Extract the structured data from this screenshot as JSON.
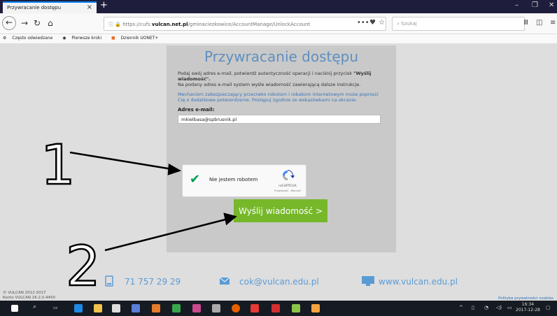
{
  "browser": {
    "tab_title": "Przywracanie dostępu",
    "tab_close": "×",
    "new_tab": "+",
    "url_prefix": "https://cufs.",
    "url_domain": "vulcan.net.pl",
    "url_path": "/gminaciezkowice/AccountManage/UnlockAccount",
    "search_placeholder": "Szukaj",
    "bookmarks": [
      "Często odwiedzane",
      "Pierwsze kroki",
      "Dziennik UONET+"
    ]
  },
  "page": {
    "title": "Przywracanie dostępu",
    "instr_a": "Podaj swój adres e-mail, potwierdź autentyczność operacji i naciśnij przycisk ",
    "instr_b": "\"Wyślij wiadomość\".",
    "instr_c": "Na podany adres e-mail system wyśle wiadomość zawierającą dalsze instrukcje.",
    "mechanism": "Mechanizm zabezpieczający przeciwko robotom i robakom internetowym może poprosić Cię o dodatkowe potwierdzenie. Postępuj zgodnie ze wskazówkami na ekranie.",
    "email_label": "Adres e-mail:",
    "email_value": "mkielbasa@spbrusnik.pl",
    "captcha_label": "Nie jestem robotem",
    "captcha_brand": "reCAPTCHA",
    "captcha_terms": "Prywatność - Warunki",
    "send_label": "Wyślij wiadomość >"
  },
  "footer": {
    "phone": "71 757 29 29",
    "email": "cok@vulcan.edu.pl",
    "website": "www.vulcan.edu.pl",
    "copyright": "© VULCAN 2012-2017",
    "version": "Konto VULCAN 16.2.0.4450",
    "policy": "Polityka prywatności cookies"
  },
  "taskbar": {
    "time": "16:34",
    "date": "2017-12-28"
  },
  "annotations": {
    "one": "1",
    "two": "2"
  },
  "colors": {
    "accent_blue": "#5e8fc0",
    "button_green": "#76b82a",
    "link_blue": "#5b9bd5"
  }
}
